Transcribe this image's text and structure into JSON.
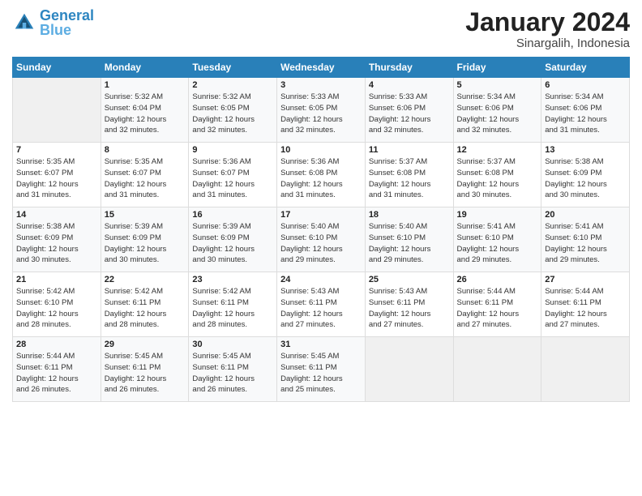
{
  "logo": {
    "line1": "General",
    "line2": "Blue"
  },
  "header": {
    "month": "January 2024",
    "location": "Sinargalih, Indonesia"
  },
  "days_of_week": [
    "Sunday",
    "Monday",
    "Tuesday",
    "Wednesday",
    "Thursday",
    "Friday",
    "Saturday"
  ],
  "weeks": [
    [
      {
        "day": "",
        "info": ""
      },
      {
        "day": "1",
        "info": "Sunrise: 5:32 AM\nSunset: 6:04 PM\nDaylight: 12 hours\nand 32 minutes."
      },
      {
        "day": "2",
        "info": "Sunrise: 5:32 AM\nSunset: 6:05 PM\nDaylight: 12 hours\nand 32 minutes."
      },
      {
        "day": "3",
        "info": "Sunrise: 5:33 AM\nSunset: 6:05 PM\nDaylight: 12 hours\nand 32 minutes."
      },
      {
        "day": "4",
        "info": "Sunrise: 5:33 AM\nSunset: 6:06 PM\nDaylight: 12 hours\nand 32 minutes."
      },
      {
        "day": "5",
        "info": "Sunrise: 5:34 AM\nSunset: 6:06 PM\nDaylight: 12 hours\nand 32 minutes."
      },
      {
        "day": "6",
        "info": "Sunrise: 5:34 AM\nSunset: 6:06 PM\nDaylight: 12 hours\nand 31 minutes."
      }
    ],
    [
      {
        "day": "7",
        "info": "Sunrise: 5:35 AM\nSunset: 6:07 PM\nDaylight: 12 hours\nand 31 minutes."
      },
      {
        "day": "8",
        "info": "Sunrise: 5:35 AM\nSunset: 6:07 PM\nDaylight: 12 hours\nand 31 minutes."
      },
      {
        "day": "9",
        "info": "Sunrise: 5:36 AM\nSunset: 6:07 PM\nDaylight: 12 hours\nand 31 minutes."
      },
      {
        "day": "10",
        "info": "Sunrise: 5:36 AM\nSunset: 6:08 PM\nDaylight: 12 hours\nand 31 minutes."
      },
      {
        "day": "11",
        "info": "Sunrise: 5:37 AM\nSunset: 6:08 PM\nDaylight: 12 hours\nand 31 minutes."
      },
      {
        "day": "12",
        "info": "Sunrise: 5:37 AM\nSunset: 6:08 PM\nDaylight: 12 hours\nand 30 minutes."
      },
      {
        "day": "13",
        "info": "Sunrise: 5:38 AM\nSunset: 6:09 PM\nDaylight: 12 hours\nand 30 minutes."
      }
    ],
    [
      {
        "day": "14",
        "info": "Sunrise: 5:38 AM\nSunset: 6:09 PM\nDaylight: 12 hours\nand 30 minutes."
      },
      {
        "day": "15",
        "info": "Sunrise: 5:39 AM\nSunset: 6:09 PM\nDaylight: 12 hours\nand 30 minutes."
      },
      {
        "day": "16",
        "info": "Sunrise: 5:39 AM\nSunset: 6:09 PM\nDaylight: 12 hours\nand 30 minutes."
      },
      {
        "day": "17",
        "info": "Sunrise: 5:40 AM\nSunset: 6:10 PM\nDaylight: 12 hours\nand 29 minutes."
      },
      {
        "day": "18",
        "info": "Sunrise: 5:40 AM\nSunset: 6:10 PM\nDaylight: 12 hours\nand 29 minutes."
      },
      {
        "day": "19",
        "info": "Sunrise: 5:41 AM\nSunset: 6:10 PM\nDaylight: 12 hours\nand 29 minutes."
      },
      {
        "day": "20",
        "info": "Sunrise: 5:41 AM\nSunset: 6:10 PM\nDaylight: 12 hours\nand 29 minutes."
      }
    ],
    [
      {
        "day": "21",
        "info": "Sunrise: 5:42 AM\nSunset: 6:10 PM\nDaylight: 12 hours\nand 28 minutes."
      },
      {
        "day": "22",
        "info": "Sunrise: 5:42 AM\nSunset: 6:11 PM\nDaylight: 12 hours\nand 28 minutes."
      },
      {
        "day": "23",
        "info": "Sunrise: 5:42 AM\nSunset: 6:11 PM\nDaylight: 12 hours\nand 28 minutes."
      },
      {
        "day": "24",
        "info": "Sunrise: 5:43 AM\nSunset: 6:11 PM\nDaylight: 12 hours\nand 27 minutes."
      },
      {
        "day": "25",
        "info": "Sunrise: 5:43 AM\nSunset: 6:11 PM\nDaylight: 12 hours\nand 27 minutes."
      },
      {
        "day": "26",
        "info": "Sunrise: 5:44 AM\nSunset: 6:11 PM\nDaylight: 12 hours\nand 27 minutes."
      },
      {
        "day": "27",
        "info": "Sunrise: 5:44 AM\nSunset: 6:11 PM\nDaylight: 12 hours\nand 27 minutes."
      }
    ],
    [
      {
        "day": "28",
        "info": "Sunrise: 5:44 AM\nSunset: 6:11 PM\nDaylight: 12 hours\nand 26 minutes."
      },
      {
        "day": "29",
        "info": "Sunrise: 5:45 AM\nSunset: 6:11 PM\nDaylight: 12 hours\nand 26 minutes."
      },
      {
        "day": "30",
        "info": "Sunrise: 5:45 AM\nSunset: 6:11 PM\nDaylight: 12 hours\nand 26 minutes."
      },
      {
        "day": "31",
        "info": "Sunrise: 5:45 AM\nSunset: 6:11 PM\nDaylight: 12 hours\nand 25 minutes."
      },
      {
        "day": "",
        "info": ""
      },
      {
        "day": "",
        "info": ""
      },
      {
        "day": "",
        "info": ""
      }
    ]
  ]
}
